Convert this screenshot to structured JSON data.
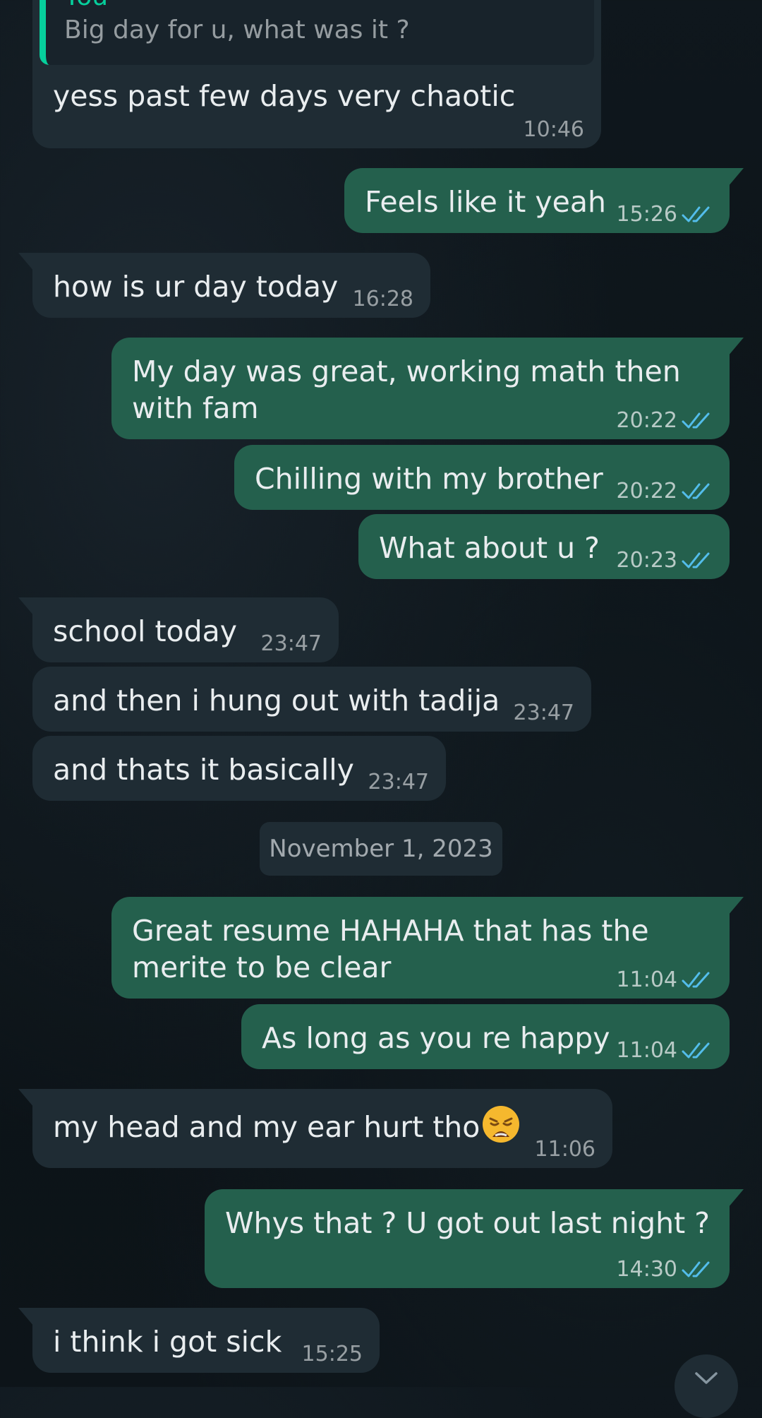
{
  "chat": {
    "quoted": {
      "author": "You",
      "text": "Big day for u, what was it ?"
    },
    "messages": [
      {
        "text": "yess past few days very chaotic",
        "time": "10:46"
      },
      {
        "text": "Feels like it yeah",
        "time": "15:26",
        "status": "read"
      },
      {
        "text": "how is ur day today",
        "time": "16:28"
      },
      {
        "text": "My day was great, working math then\nwith fam",
        "time": "20:22",
        "status": "read"
      },
      {
        "text": "Chilling with my brother",
        "time": "20:22",
        "status": "read"
      },
      {
        "text": "What about u ?",
        "time": "20:23",
        "status": "read"
      },
      {
        "text": "school today",
        "time": "23:47"
      },
      {
        "text": "and then i hung out with tadija",
        "time": "23:47"
      },
      {
        "text": "and thats it basically",
        "time": "23:47"
      },
      {
        "text": "Great resume HAHAHA that has the\nmerite to be clear",
        "time": "11:04",
        "status": "read"
      },
      {
        "text": "As long as you re happy",
        "time": "11:04",
        "status": "read"
      },
      {
        "text": "my head and my ear hurt tho",
        "emoji": "weary-face-emoji",
        "time": "11:06"
      },
      {
        "text": "Whys that ? U got out last night ?",
        "time": "14:30",
        "status": "read"
      },
      {
        "text": "i think i got sick",
        "time": "15:25"
      }
    ],
    "date_separator": "November 1, 2023"
  },
  "icons": {
    "read_ticks": "double-check-icon",
    "scroll": "chevron-down-icon"
  },
  "colors": {
    "incoming_bubble": "#1f2c34",
    "outgoing_bubble": "#24604d",
    "read_tick": "#53bdeb",
    "quote_accent": "#06cf9c"
  }
}
